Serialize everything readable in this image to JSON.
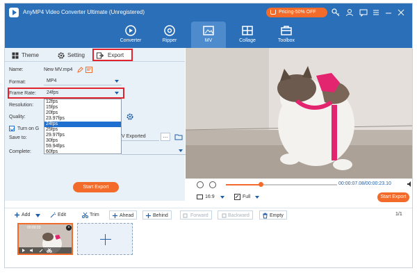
{
  "app": {
    "title": "AnyMP4 Video Converter Ultimate (Unregistered)",
    "promo": "Pricing-50% OFF"
  },
  "nav": {
    "items": [
      {
        "label": "Converter",
        "icon": "converter-icon"
      },
      {
        "label": "Ripper",
        "icon": "disc-icon"
      },
      {
        "label": "MV",
        "icon": "mv-icon"
      },
      {
        "label": "Collage",
        "icon": "collage-icon"
      },
      {
        "label": "Toolbox",
        "icon": "toolbox-icon"
      }
    ],
    "active": "MV"
  },
  "tabs": {
    "theme": "Theme",
    "setting": "Setting",
    "export": "Export"
  },
  "export_form": {
    "name_label": "Name:",
    "name_value": "New MV.mp4",
    "format_label": "Format:",
    "format_value": "MP4",
    "frame_rate_label": "Frame Rate:",
    "frame_rate_value": "24fps",
    "resolution_label": "Resolution:",
    "quality_label": "Quality:",
    "turn_on_label": "Turn on G",
    "save_to_label": "Save to:",
    "save_to_value": "V Exported",
    "complete_label": "Complete:",
    "start_export": "Start Export",
    "frame_rate_options": [
      "12fps",
      "15fps",
      "20fps",
      "23.97fps",
      "24fps",
      "25fps",
      "29.97fps",
      "30fps",
      "59.94fps",
      "60fps"
    ],
    "frame_rate_selected_index": 4
  },
  "player": {
    "time": "00:00:07.08/00:00:23.10",
    "progress_fraction": 0.31,
    "aspect": "16:9",
    "zoom": "Full",
    "start_export": "Start Export"
  },
  "toolbar": {
    "add": "Add",
    "edit": "Edit",
    "trim": "Trim",
    "ahead": "Ahead",
    "behind": "Behind",
    "forward": "Forward",
    "backward": "Backward",
    "empty": "Empty",
    "page": "1/1"
  },
  "clip": {
    "duration": "00:00:23"
  }
}
